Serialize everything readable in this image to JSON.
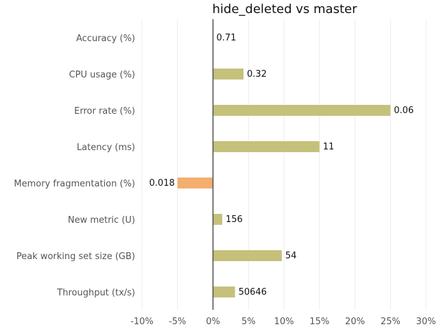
{
  "chart_data": {
    "type": "bar",
    "orientation": "horizontal",
    "title": "hide_deleted vs master",
    "xlabel": "",
    "ylabel": "",
    "xlim": [
      -10,
      30
    ],
    "x_ticks": [
      -10,
      -5,
      0,
      5,
      10,
      15,
      20,
      25,
      30
    ],
    "x_tick_labels": [
      "-10%",
      "-5%",
      "0%",
      "5%",
      "10%",
      "15%",
      "20%",
      "25%",
      "30%"
    ],
    "grid": "vertical",
    "categories": [
      "Accuracy (%)",
      "CPU usage (%)",
      "Error rate (%)",
      "Latency (ms)",
      "Memory fragmentation (%)",
      "New metric (U)",
      "Peak working set size (GB)",
      "Throughput (tx/s)"
    ],
    "values": [
      0,
      4.3,
      25,
      15,
      -5,
      1.3,
      9.7,
      3.1
    ],
    "value_labels": [
      "0.71",
      "0.32",
      "0.06",
      "11",
      "0.018",
      "156",
      "54",
      "50646"
    ],
    "colors": {
      "positive": "#c5c17b",
      "negative": "#f4ae70",
      "zero_line": "#555555",
      "grid": "#ececec"
    }
  }
}
